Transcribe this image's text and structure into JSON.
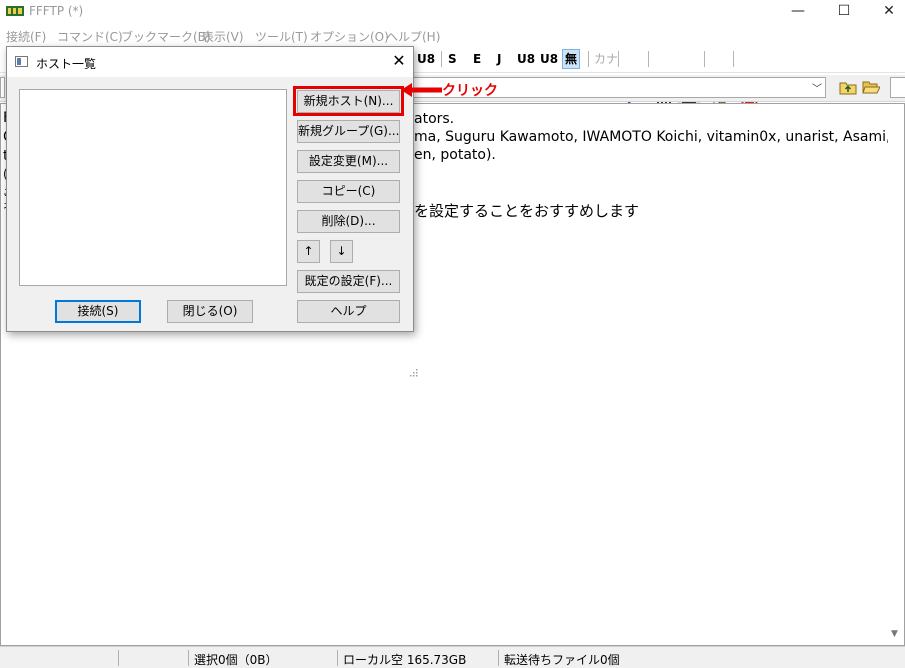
{
  "window": {
    "title": "FFFTP (*)",
    "controls": {
      "minimize": "—",
      "maximize": "☐",
      "close": "✕"
    }
  },
  "menubar": [
    "接続(F)",
    "コマンド(C)",
    "ブックマーク(B)",
    "表示(V)",
    "ツール(T)",
    "オプション(O)",
    "ヘルプ(H)"
  ],
  "toolbar": {
    "buttons": [
      "U8",
      "S",
      "E",
      "J",
      "U8",
      "U8",
      "無",
      "カナ",
      "↺",
      "▦",
      "▦"
    ],
    "icons": [
      "refresh-icon",
      "list-view-icon",
      "detail-view-icon",
      "tree-icon",
      "stop-icon"
    ]
  },
  "log": {
    "lines": [
      "ators.",
      "ma, Suguru Kawamoto, IWAMOTO Koichi, vitamin0x, unarist, Asami,",
      "en, potato).",
      "を設定することをおすすめします"
    ],
    "left_fragments": [
      "F",
      "C",
      "t",
      "(",
      "ご",
      "ネ"
    ]
  },
  "dialog": {
    "title": "ホスト一覧",
    "close": "✕",
    "buttons": {
      "new_host": "新規ホスト(N)...",
      "new_group": "新規グループ(G)...",
      "edit": "設定変更(M)...",
      "copy": "コピー(C)",
      "delete": "削除(D)...",
      "up": "↑",
      "down": "↓",
      "defaults": "既定の設定(F)...",
      "help": "ヘルプ",
      "connect": "接続(S)",
      "close": "閉じる(O)"
    }
  },
  "annotation": {
    "text": "クリック",
    "color": "#e60000"
  },
  "statusbar": {
    "selection": "選択0個（0B）",
    "local_free": "ローカル空 165.73GB",
    "queue": "転送待ちファイル0個"
  }
}
